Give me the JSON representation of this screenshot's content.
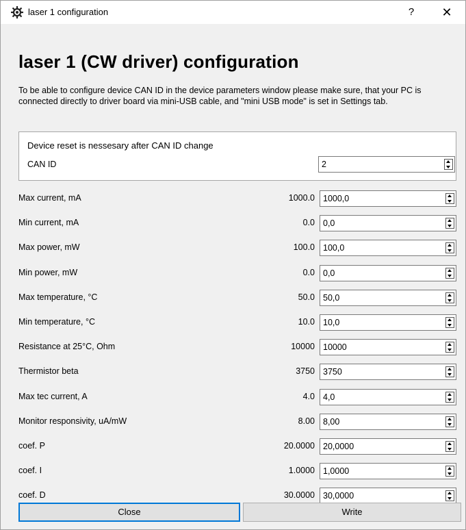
{
  "window": {
    "title": "laser 1 configuration",
    "help_label": "?",
    "close_label": "✕"
  },
  "heading": "laser 1 (CW driver) configuration",
  "intro": "To be able to configure device CAN ID in the device parameters window please make sure, that your PC is connected directly to driver board via mini-USB cable, and \"mini USB mode\" is set in Settings tab.",
  "can_section": {
    "note": "Device reset is nessesary after CAN ID change",
    "label": "CAN ID",
    "value": "2",
    "input": "2"
  },
  "params": [
    {
      "label": "Max current, mA",
      "value": "1000.0",
      "input": "1000,0"
    },
    {
      "label": "Min current, mA",
      "value": "0.0",
      "input": "0,0"
    },
    {
      "label": "Max power, mW",
      "value": "100.0",
      "input": "100,0"
    },
    {
      "label": "Min power, mW",
      "value": "0.0",
      "input": "0,0"
    },
    {
      "label": "Max temperature, °C",
      "value": "50.0",
      "input": "50,0"
    },
    {
      "label": "Min temperature, °C",
      "value": "10.0",
      "input": "10,0"
    },
    {
      "label": "Resistance at 25°C, Ohm",
      "value": "10000",
      "input": "10000"
    },
    {
      "label": "Thermistor beta",
      "value": "3750",
      "input": "3750"
    },
    {
      "label": "Max tec current, A",
      "value": "4.0",
      "input": "4,0"
    },
    {
      "label": "Monitor responsivity, uA/mW",
      "value": "8.00",
      "input": "8,00"
    },
    {
      "label": "coef. P",
      "value": "20.0000",
      "input": "20,0000"
    },
    {
      "label": "coef. I",
      "value": "1.0000",
      "input": "1,0000"
    },
    {
      "label": "coef. D",
      "value": "30.0000",
      "input": "30,0000"
    }
  ],
  "buttons": {
    "close": "Close",
    "write": "Write"
  },
  "colors": {
    "focus_border": "#0078d7",
    "window_bg": "#f0f0f0"
  }
}
